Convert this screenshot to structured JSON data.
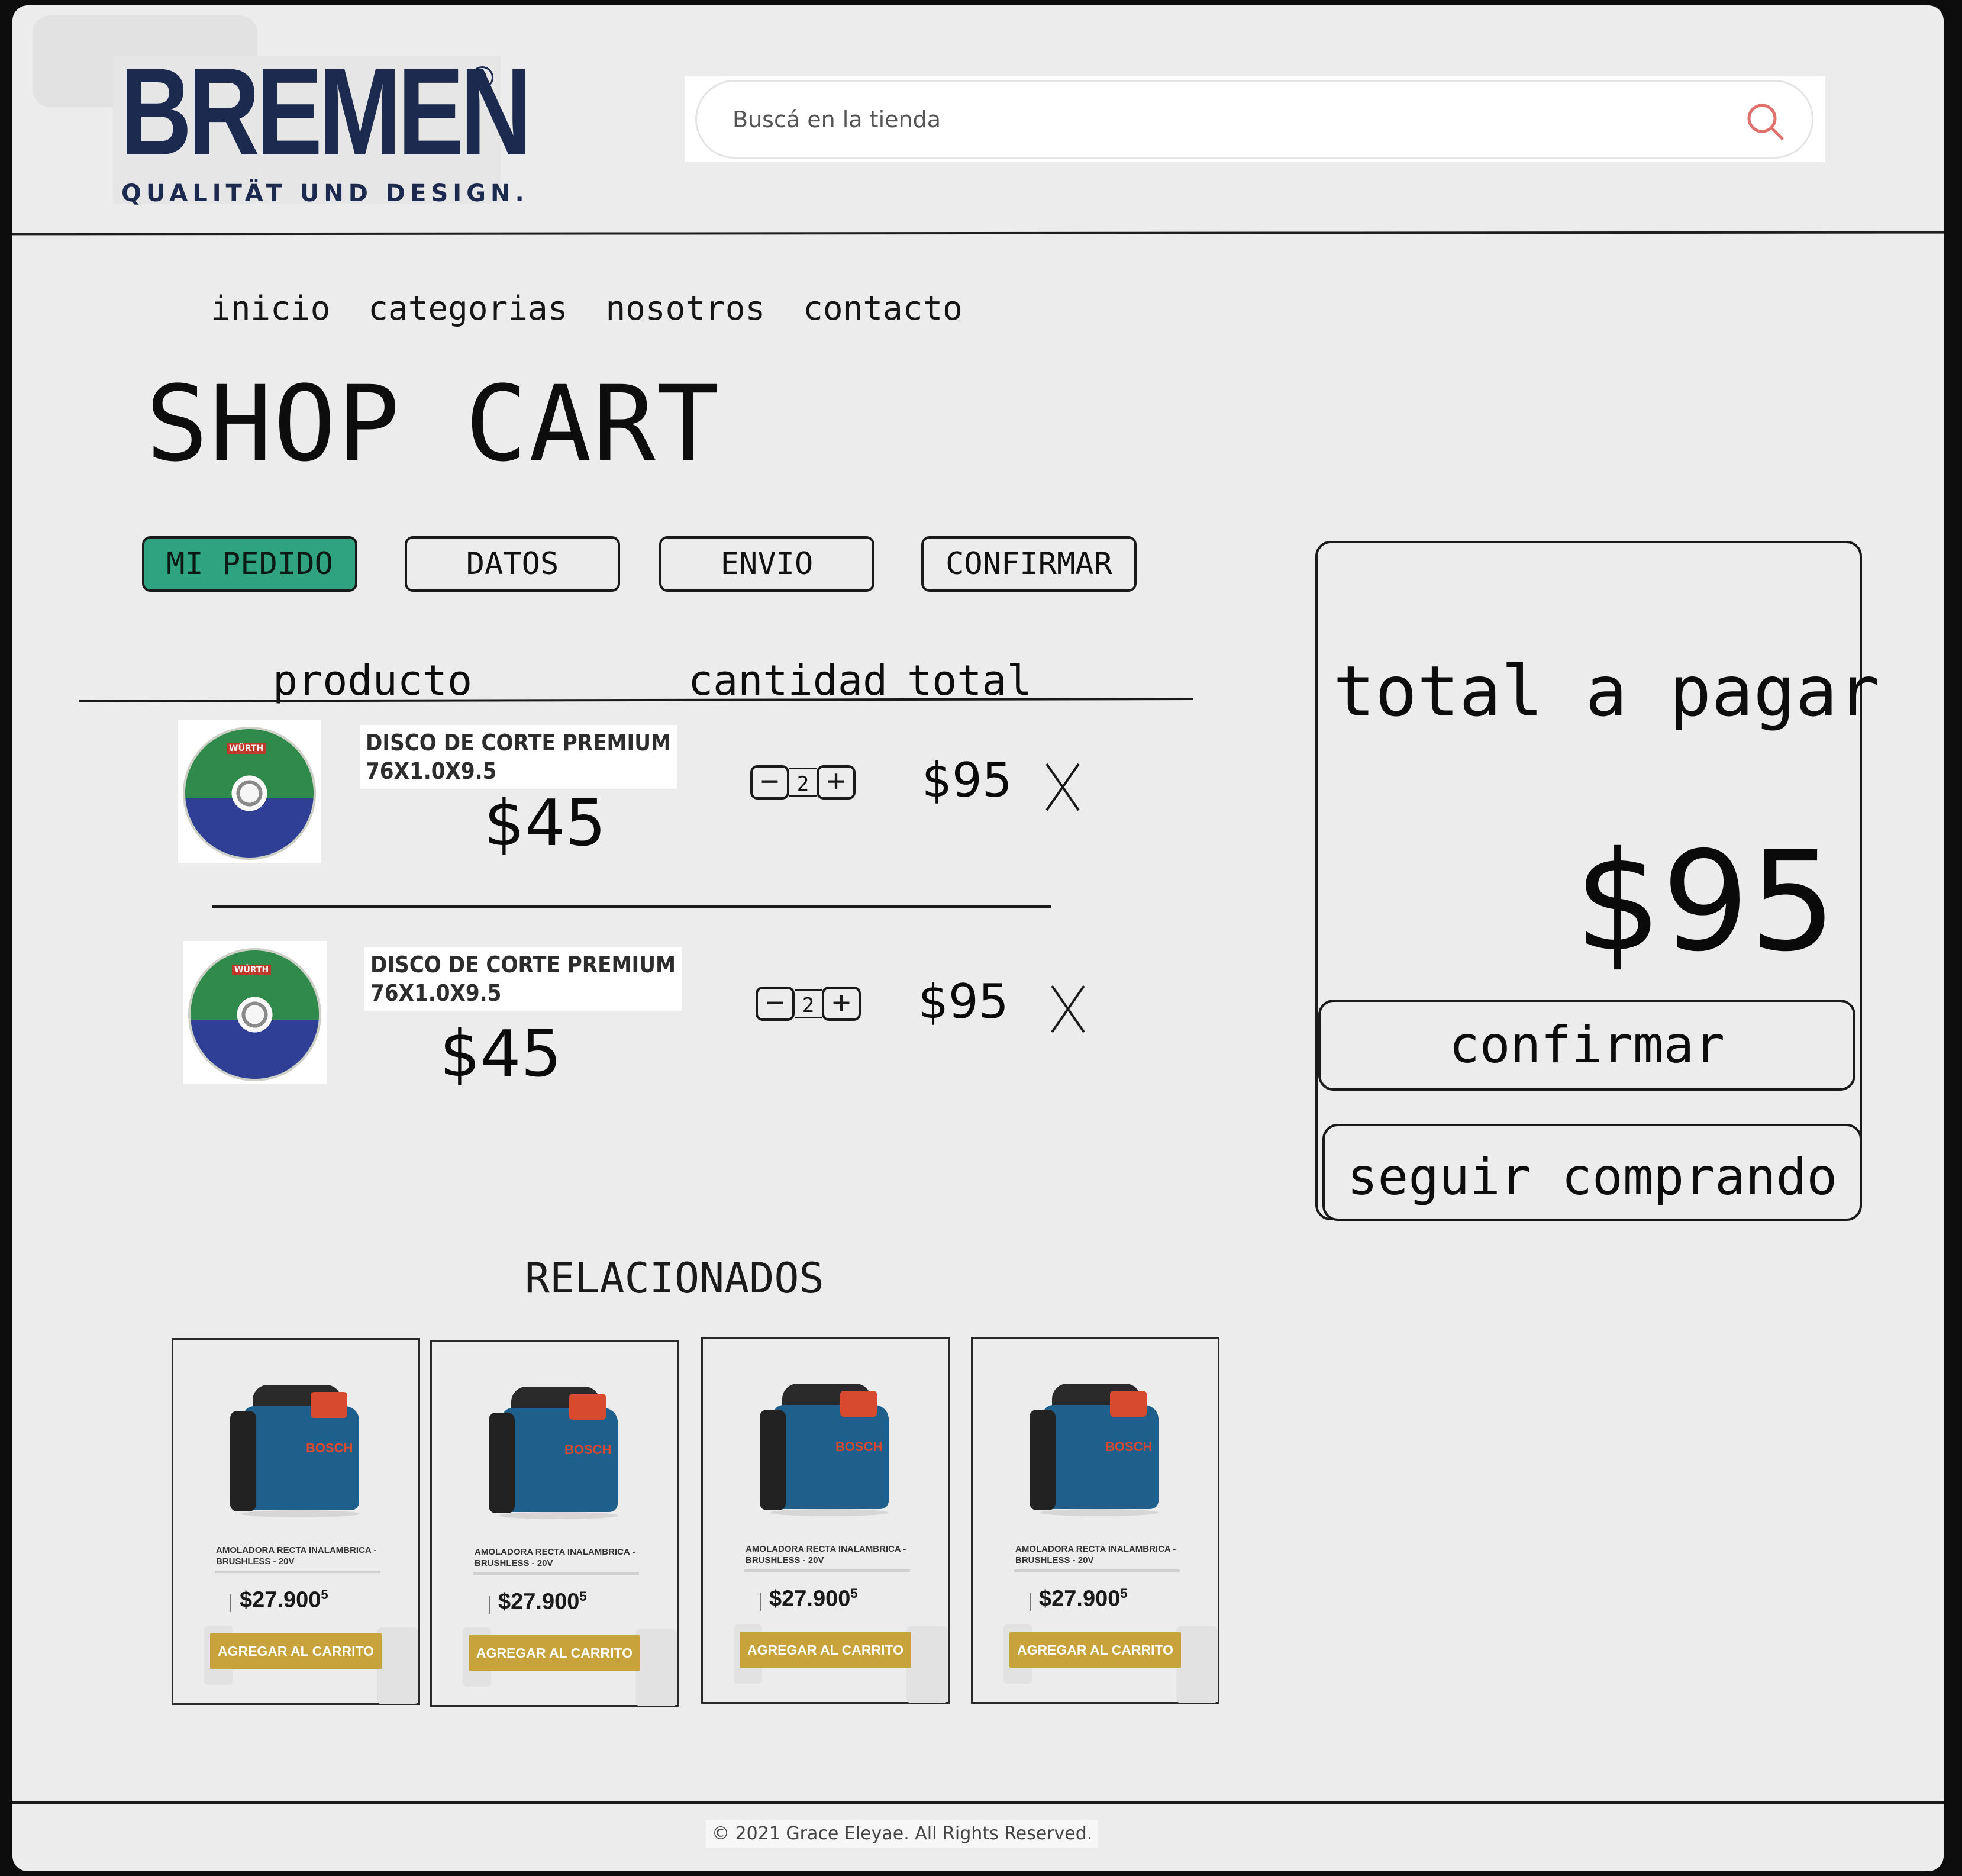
{
  "brand": {
    "name": "BREMEN",
    "tagline": "QUALITÄT UND DESIGN."
  },
  "search": {
    "placeholder": "Buscá en la tienda"
  },
  "nav": {
    "items": [
      "inicio",
      "categorias",
      "nosotros",
      "contacto"
    ]
  },
  "page": {
    "title": "SHOP CART"
  },
  "steps": [
    {
      "label": "MI PEDIDO",
      "active": true
    },
    {
      "label": "DATOS",
      "active": false
    },
    {
      "label": "ENVIO",
      "active": false
    },
    {
      "label": "CONFIRMAR",
      "active": false
    }
  ],
  "table": {
    "headers": {
      "product": "producto",
      "quantity": "cantidad",
      "total": "total"
    }
  },
  "cart": {
    "items": [
      {
        "name_line1": "DISCO DE CORTE PREMIUM",
        "name_line2": "76X1.0X9.5",
        "price": "$45",
        "quantity": "2",
        "line_total": "$95",
        "thumb_brand": "WÜRTH"
      },
      {
        "name_line1": "DISCO DE CORTE PREMIUM",
        "name_line2": "76X1.0X9.5",
        "price": "$45",
        "quantity": "2",
        "line_total": "$95",
        "thumb_brand": "WÜRTH"
      }
    ]
  },
  "summary": {
    "title": "total a pagar",
    "amount": "$95",
    "confirm_label": "confirmar",
    "continue_label": "seguir comprando"
  },
  "related": {
    "title": "RELACIONADOS",
    "products": [
      {
        "name": "AMOLADORA RECTA INALAMBRICA - BRUSHLESS - 20V",
        "price": "$27.900",
        "price_sup": "5",
        "button": "AGREGAR AL CARRITO",
        "brand": "BOSCH"
      },
      {
        "name": "AMOLADORA RECTA INALAMBRICA - BRUSHLESS - 20V",
        "price": "$27.900",
        "price_sup": "5",
        "button": "AGREGAR AL CARRITO",
        "brand": "BOSCH"
      },
      {
        "name": "AMOLADORA RECTA INALAMBRICA - BRUSHLESS - 20V",
        "price": "$27.900",
        "price_sup": "5",
        "button": "AGREGAR AL CARRITO",
        "brand": "BOSCH"
      },
      {
        "name": "AMOLADORA RECTA INALAMBRICA - BRUSHLESS - 20V",
        "price": "$27.900",
        "price_sup": "5",
        "button": "AGREGAR AL CARRITO",
        "brand": "BOSCH"
      }
    ]
  },
  "footer": {
    "copyright": "© 2021 Grace Eleyae. All Rights Reserved."
  },
  "colors": {
    "active_step": "#2fa37f",
    "add_to_cart": "#c8a33b",
    "brand_navy": "#1d2a4f",
    "search_icon": "#e0726e"
  },
  "icons": {
    "search": "search-icon",
    "remove": "close-icon",
    "decrement": "minus-icon",
    "increment": "plus-icon"
  }
}
